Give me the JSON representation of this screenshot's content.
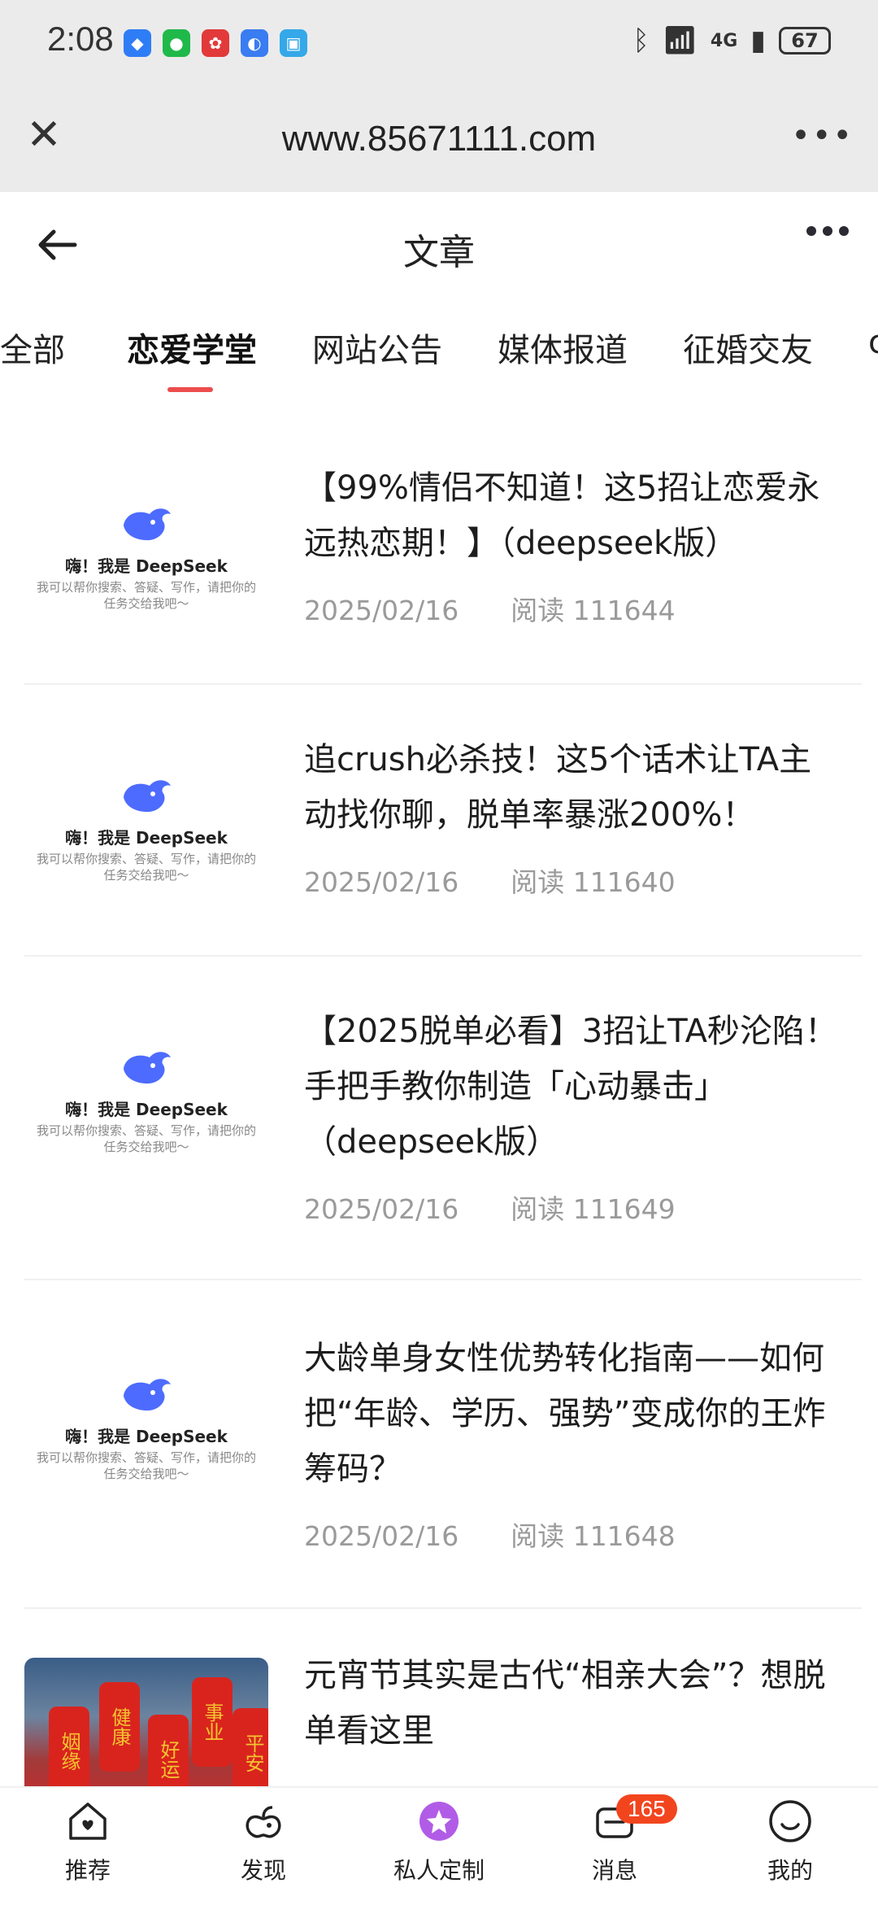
{
  "status": {
    "time": "2:08",
    "battery": "67",
    "network": "4G"
  },
  "browser": {
    "url": "www.85671111.com"
  },
  "nav": {
    "title": "文章"
  },
  "tabs": [
    "全部",
    "恋爱学堂",
    "网站公告",
    "媒体报道",
    "征婚交友",
    "c"
  ],
  "active_tab": "恋爱学堂",
  "thumb": {
    "brand": "嗨！我是 DeepSeek",
    "tagline_1": "我可以帮你搜索、答疑、写作，请把你的",
    "tagline_2": "任务交给我吧～"
  },
  "articles": [
    {
      "title": "【99%情侣不知道！这5招让恋爱永远热恋期！】（deepseek版）",
      "date": "2025/02/16",
      "reads": "阅读 111644"
    },
    {
      "title": "追crush必杀技！这5个话术让TA主动找你聊，脱单率暴涨200%！",
      "date": "2025/02/16",
      "reads": "阅读 111640"
    },
    {
      "title": "【2025脱单必看】3招让TA秒沦陷！手把手教你制造「心动暴击」（deepseek版）",
      "date": "2025/02/16",
      "reads": "阅读 111649"
    },
    {
      "title": "大龄单身女性优势转化指南——如何把“年龄、学历、强势”变成你的王炸筹码？",
      "date": "2025/02/16",
      "reads": "阅读 111648"
    },
    {
      "title": "元宵节其实是古代“相亲大会”？想脱单看这里",
      "date": "",
      "reads": ""
    }
  ],
  "lanterns": [
    "姻缘",
    "健康",
    "好运",
    "事业",
    "平安"
  ],
  "bottom_nav": [
    {
      "label": "推荐",
      "icon": "home-heart-icon"
    },
    {
      "label": "发现",
      "icon": "discover-icon"
    },
    {
      "label": "私人定制",
      "icon": "star-custom-icon"
    },
    {
      "label": "消息",
      "icon": "message-icon",
      "badge": "165"
    },
    {
      "label": "我的",
      "icon": "smile-profile-icon"
    }
  ],
  "colors": {
    "accent": "#ec4d4d",
    "badge": "#f2451e",
    "custom_purple": "#b15ce6",
    "deepseek_blue": "#4d6bfe"
  }
}
